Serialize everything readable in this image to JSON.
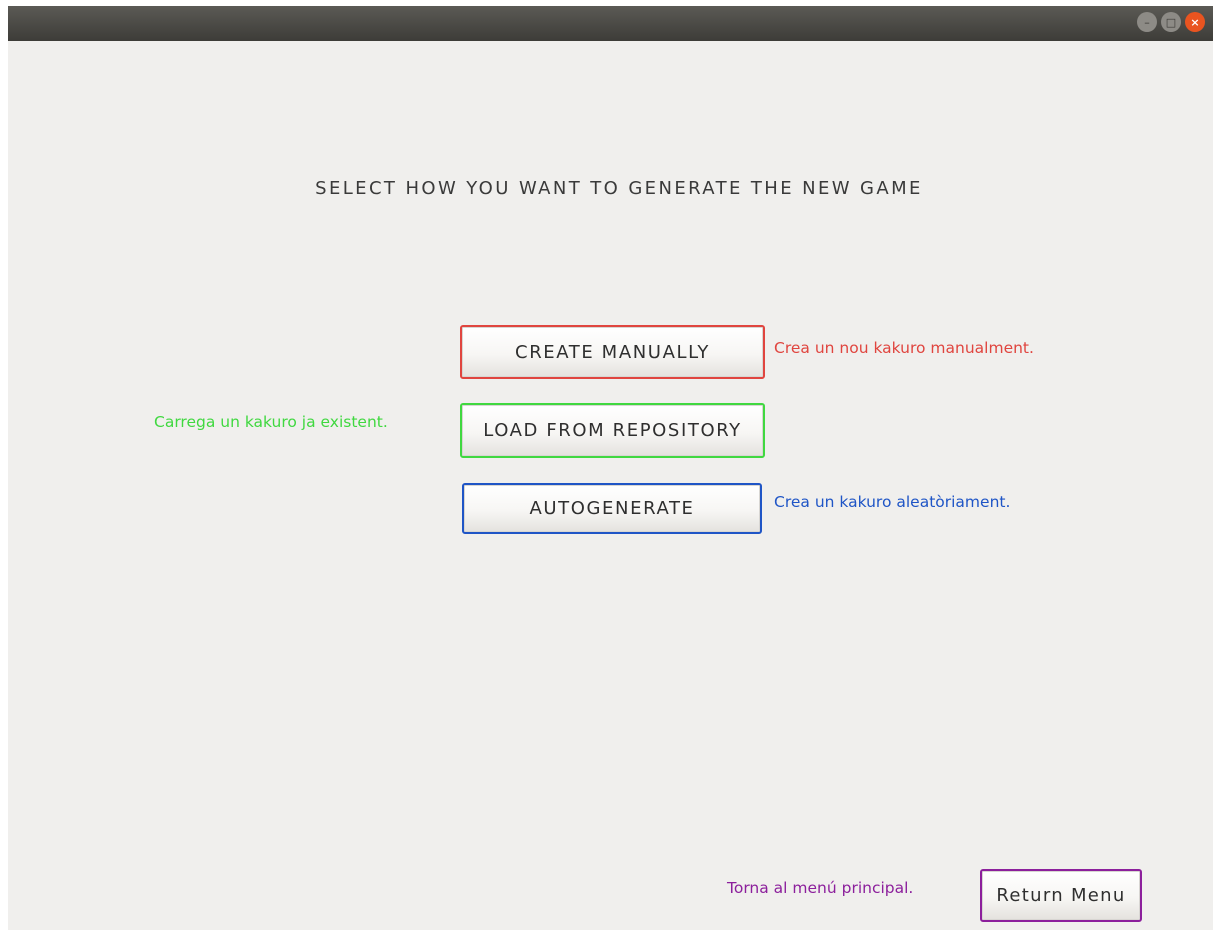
{
  "titlebar": {
    "controls": [
      {
        "name": "minimize",
        "glyph": "–"
      },
      {
        "name": "maximize",
        "glyph": "□"
      },
      {
        "name": "close",
        "glyph": "×"
      }
    ]
  },
  "heading": "SELECT HOW YOU WANT TO GENERATE THE NEW GAME",
  "options": {
    "create": {
      "label": "CREATE MANUALLY",
      "hint": "Crea un nou kakuro manualment.",
      "color": "#e0453f"
    },
    "load": {
      "label": "LOAD FROM REPOSITORY",
      "hint": "Carrega un kakuro ja existent.",
      "color": "#40d840"
    },
    "auto": {
      "label": "AUTOGENERATE",
      "hint": "Crea un kakuro aleatòriament.",
      "color": "#1f55c6"
    }
  },
  "return": {
    "label": "Return Menu",
    "hint": "Torna al menú principal.",
    "color": "#8c1f9c"
  },
  "theme": {
    "background": "#f0efed",
    "titlebar": "#4a4945",
    "close_button": "#e95420"
  }
}
